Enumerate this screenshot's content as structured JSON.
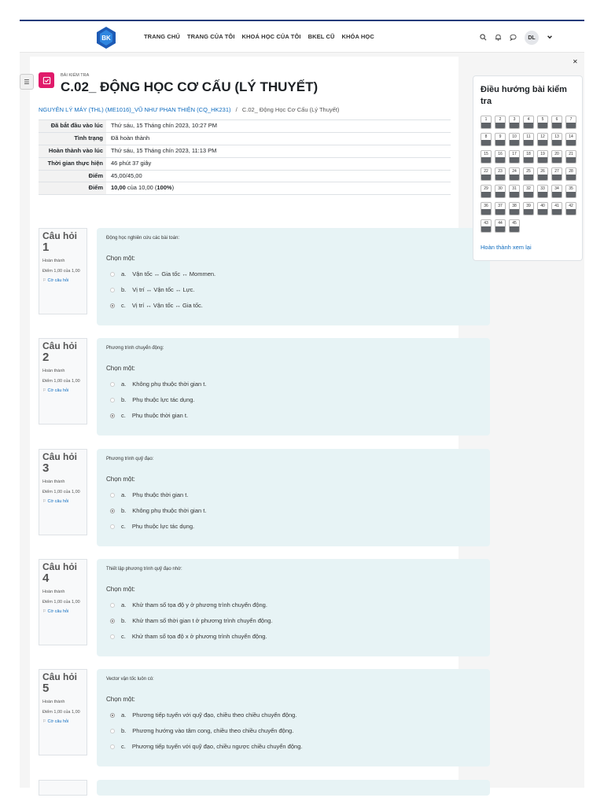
{
  "nav": {
    "items": [
      "TRANG CHỦ",
      "TRANG CỦA TÔI",
      "KHOÁ HỌC CỦA TÔI",
      "BKEL CŨ",
      "KHÓA HỌC"
    ],
    "avatar_initials": "DL"
  },
  "header": {
    "activity_type": "BÀI KIỂM TRA",
    "title": "C.02_ ĐỘNG HỌC CƠ CẤU (LÝ THUYẾT)"
  },
  "breadcrumb": {
    "course": "NGUYÊN LÝ MÁY (THL) (ME1016)_VŨ NHƯ PHAN THIỆN (CQ_HK231)",
    "separator": "/",
    "current": "C.02_ Động Học Cơ Cấu (Lý Thuyết)"
  },
  "summary": [
    {
      "label": "Đã bắt đầu vào lúc",
      "value": "Thứ sáu, 15 Tháng chín 2023, 10:27 PM"
    },
    {
      "label": "Tình trạng",
      "value": "Đã hoàn thành"
    },
    {
      "label": "Hoàn thành vào lúc",
      "value": "Thứ sáu, 15 Tháng chín 2023, 11:13 PM"
    },
    {
      "label": "Thời gian thực hiện",
      "value": "46 phút 37 giây"
    },
    {
      "label": "Điểm",
      "value": "45,00/45,00"
    },
    {
      "label": "Điểm",
      "value_bold": "10,00",
      "value_mid": " của 10,00 (",
      "value_pct": "100%",
      "value_end": ")"
    }
  ],
  "question_labels": {
    "q": "Câu hỏi",
    "state": "Hoàn thành",
    "grade": "Điểm 1,00 của 1,00",
    "flag": "Cờ câu hỏi",
    "prompt": "Chọn một:"
  },
  "questions": [
    {
      "num": "1",
      "text": "Động học nghiên cứu các bài toán:",
      "options": [
        {
          "letter": "a.",
          "text": "Vận tốc ↔ Gia tốc ↔ Mommen.",
          "checked": false
        },
        {
          "letter": "b.",
          "text": "Vị trí ↔ Vận tốc ↔ Lực.",
          "checked": false
        },
        {
          "letter": "c.",
          "text": "Vị trí ↔ Vận tốc ↔ Gia tốc.",
          "checked": true
        }
      ]
    },
    {
      "num": "2",
      "text": "Phương trình chuyển động:",
      "options": [
        {
          "letter": "a.",
          "text": "Không phụ thuộc thời gian t.",
          "checked": false
        },
        {
          "letter": "b.",
          "text": "Phụ thuộc lực tác dụng.",
          "checked": false
        },
        {
          "letter": "c.",
          "text": "Phụ thuộc thời gian t.",
          "checked": true
        }
      ]
    },
    {
      "num": "3",
      "text": "Phương trình quỹ đạo:",
      "options": [
        {
          "letter": "a.",
          "text": "Phụ thuộc thời gian t.",
          "checked": false
        },
        {
          "letter": "b.",
          "text": "Không phụ thuộc thời gian t.",
          "checked": true
        },
        {
          "letter": "c.",
          "text": "Phụ thuộc lực tác dụng.",
          "checked": false
        }
      ]
    },
    {
      "num": "4",
      "text": "Thiết lập phương trình quỹ đạo nhờ:",
      "options": [
        {
          "letter": "a.",
          "text": "Khử tham số tọa độ y ở phương trình chuyển động.",
          "checked": false
        },
        {
          "letter": "b.",
          "text": "Khử tham số thời gian t ở phương trình chuyển động.",
          "checked": true
        },
        {
          "letter": "c.",
          "text": "Khử tham số tọa độ x ở phương trình chuyển động.",
          "checked": false
        }
      ]
    },
    {
      "num": "5",
      "text": "Vector vận tốc luôn có:",
      "options": [
        {
          "letter": "a.",
          "text": "Phương tiếp tuyến với quỹ đạo, chiều theo chiều chuyển động.",
          "checked": true
        },
        {
          "letter": "b.",
          "text": "Phương hướng vào tâm cong, chiều theo chiều chuyển động.",
          "checked": false
        },
        {
          "letter": "c.",
          "text": "Phương tiếp tuyến với quỹ đạo, chiều ngược chiều chuyển động.",
          "checked": false
        }
      ]
    }
  ],
  "quiz_nav": {
    "title": "Điều hướng bài kiểm tra",
    "count": 45,
    "finish_review": "Hoàn thành xem lại"
  },
  "colors": {
    "brand": "#1d3b7a",
    "quiz_icon": "#e01a6a",
    "link": "#0f6cbf",
    "question_bg": "#e7f3f5"
  }
}
